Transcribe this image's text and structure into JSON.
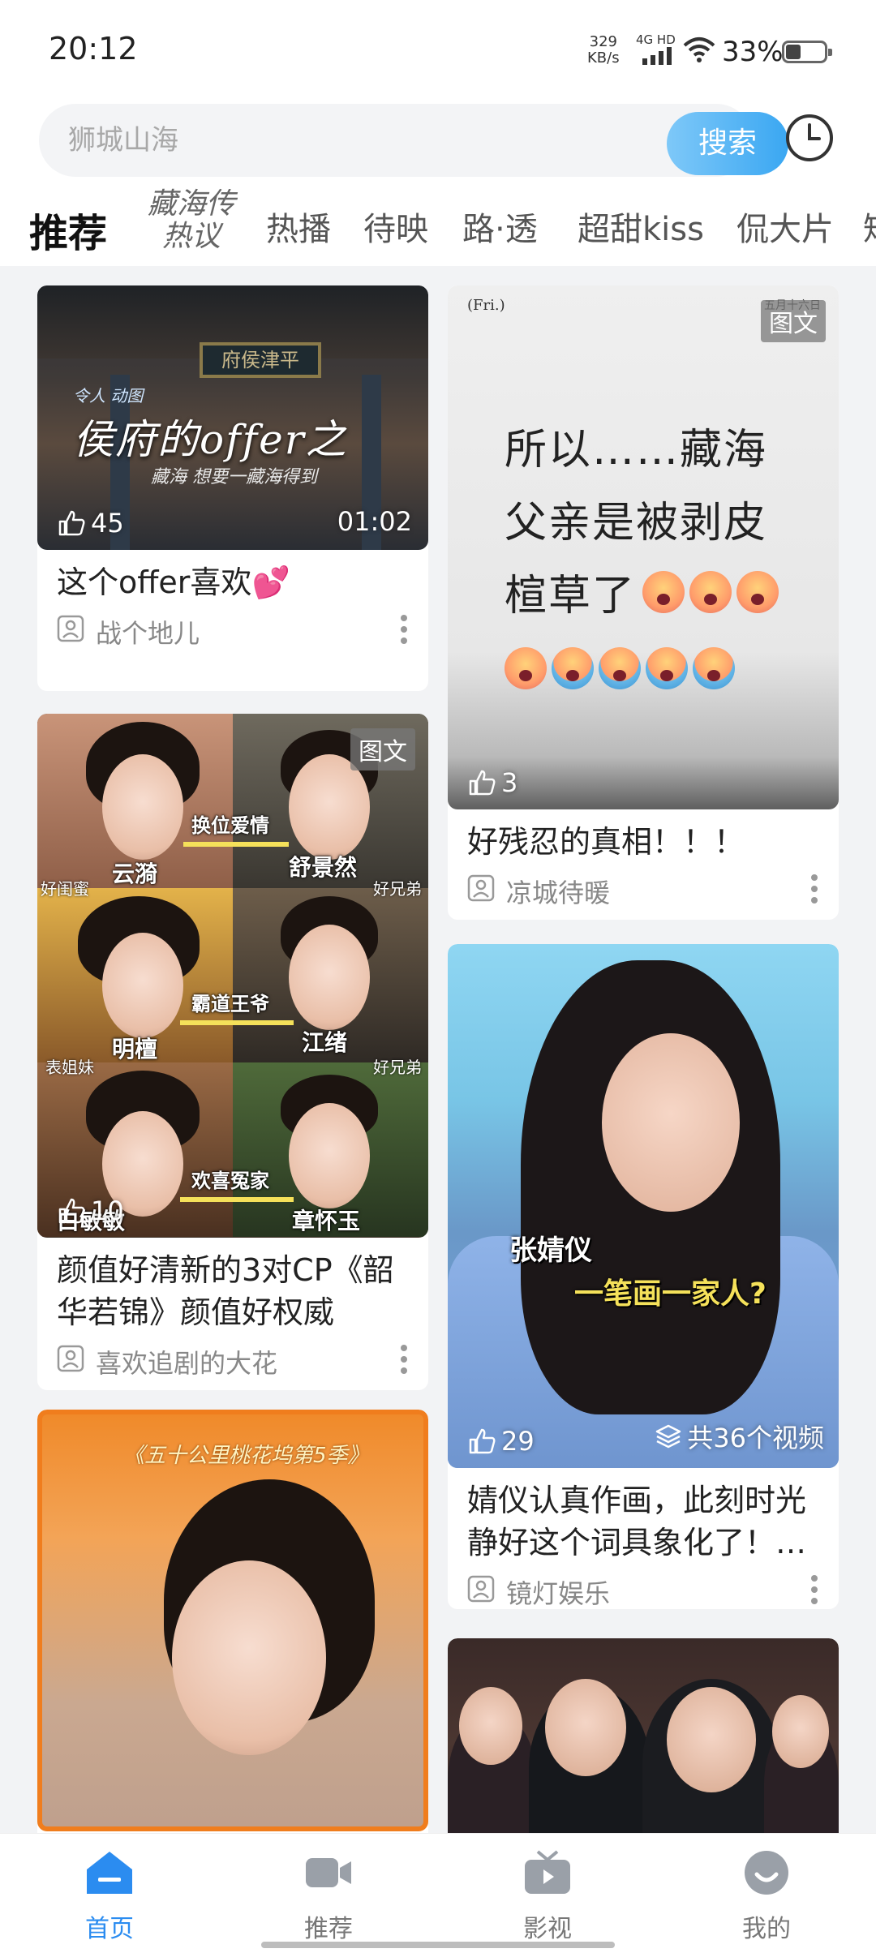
{
  "status_bar": {
    "time": "20:12",
    "net_speed": "329",
    "net_unit": "KB/s",
    "network": "4G HD",
    "battery": "33%"
  },
  "search": {
    "placeholder": "狮城山海",
    "button": "搜索",
    "history_icon": "clock-icon"
  },
  "tabs": [
    {
      "label": "推荐",
      "active": true
    },
    {
      "label": "藏海传",
      "sub": "热议"
    },
    {
      "label": "热播"
    },
    {
      "label": "待映"
    },
    {
      "label": "路·透"
    },
    {
      "label": "超甜kiss"
    },
    {
      "label": "侃大片"
    },
    {
      "label": "短"
    }
  ],
  "cards": [
    {
      "thumb_title": "侯府的offer之",
      "thumb_plaque": "府侯津平",
      "thumb_sub": "藏海 想要一藏海得到",
      "thumb_top": "令人 动图",
      "likes": "45",
      "duration": "01:02",
      "title": "这个offer喜欢",
      "title_emoji": "💕",
      "author": "战个地儿"
    },
    {
      "tag": "图文",
      "thumb_corner": "(Fri.)",
      "thumb_corner_right": "五月十六日",
      "thumb_lines": [
        "所以……藏海",
        "父亲是被剥皮",
        "楦草了"
      ],
      "likes": "3",
      "title": "好残忍的真相！！！",
      "author": "凉城待暖"
    },
    {
      "tag": "图文",
      "grid_labels": [
        "云漪",
        "舒景然",
        "明檀",
        "江绪",
        "白敏敏",
        "章怀玉"
      ],
      "grid_links": [
        "换位爱情",
        "霸道王爷",
        "欢喜冤家"
      ],
      "grid_side": [
        "好闺蜜",
        "好兄弟",
        "表姐妹",
        "好兄弟"
      ],
      "likes": "10",
      "title": "颜值好清新的3对CP《韶华若锦》颜值好权威",
      "author": "喜欢追剧的大花"
    },
    {
      "caption1": "张婧仪",
      "caption2": "一笔画一家人?",
      "likes": "29",
      "video_count": "共36个视频",
      "title": "婧仪认真作画，此刻时光静好这个词具象化了！…",
      "author": "镜灯娱乐"
    },
    {
      "banner": "《五十公里桃花坞第5季》"
    },
    {}
  ],
  "bottom_nav": [
    {
      "label": "首页",
      "icon": "home-icon",
      "active": true
    },
    {
      "label": "推荐",
      "icon": "video-camera-icon"
    },
    {
      "label": "影视",
      "icon": "tv-play-icon"
    },
    {
      "label": "我的",
      "icon": "smiley-profile-icon"
    }
  ],
  "colors": {
    "accent": "#2b8cf0",
    "search_button": "#4db0f4",
    "background": "#f2f3f5"
  }
}
